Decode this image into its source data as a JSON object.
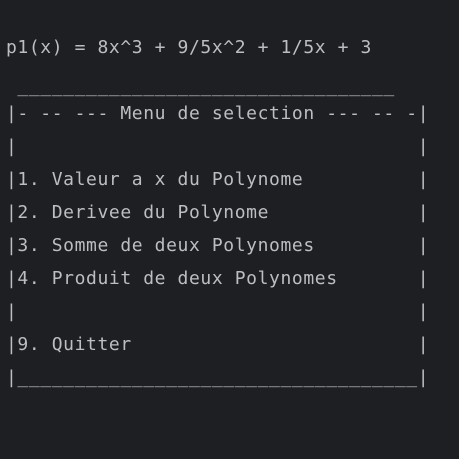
{
  "terminal": {
    "lines": [
      "p1(x) = 8x^3 + 9/5x^2 + 1/5x + 3",
      " _________________________________",
      "|- -- --- Menu de selection --- -- -|",
      "|                                   |",
      "|1. Valeur a x du Polynome          |",
      "|2. Derivee du Polynome             |",
      "|3. Somme de deux Polynomes         |",
      "|4. Produit de deux Polynomes       |",
      "|                                   |",
      "|9. Quitter                         |",
      "|___________________________________|"
    ]
  }
}
